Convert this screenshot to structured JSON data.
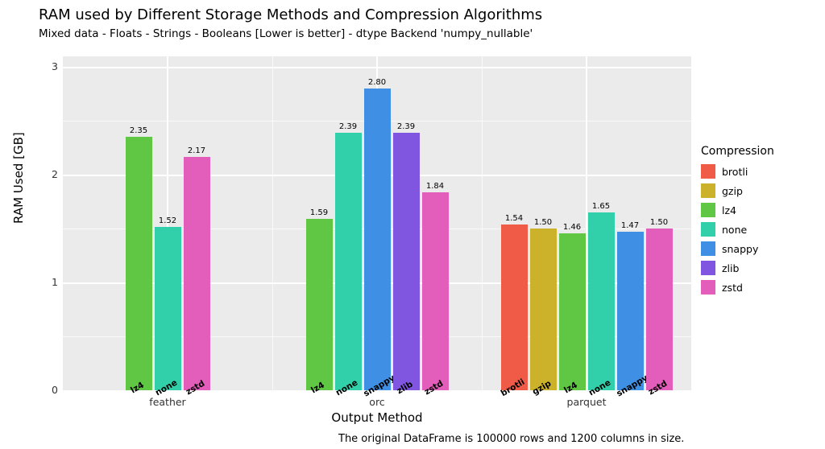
{
  "chart_data": {
    "type": "bar",
    "title": "RAM used by Different Storage Methods and Compression Algorithms",
    "subtitle": "Mixed data - Floats - Strings - Booleans [Lower is better] - dtype Backend 'numpy_nullable'",
    "xlabel": "Output Method",
    "ylabel": "RAM Used [GB]",
    "caption": "The original DataFrame is 100000 rows and 1200 columns in size.",
    "ylim": [
      0,
      3.1
    ],
    "yticks": [
      0,
      1,
      2,
      3
    ],
    "legend_title": "Compression",
    "series": [
      {
        "name": "brotli",
        "color": "#f05b47"
      },
      {
        "name": "gzip",
        "color": "#ccb22b"
      },
      {
        "name": "lz4",
        "color": "#5fc744"
      },
      {
        "name": "none",
        "color": "#32d0aa"
      },
      {
        "name": "snappy",
        "color": "#3f90e5"
      },
      {
        "name": "zlib",
        "color": "#8055e0"
      },
      {
        "name": "zstd",
        "color": "#e35dbb"
      }
    ],
    "groups": [
      {
        "name": "feather",
        "bars": [
          {
            "compression": "lz4",
            "value": 2.35
          },
          {
            "compression": "none",
            "value": 1.52
          },
          {
            "compression": "zstd",
            "value": 2.17
          }
        ]
      },
      {
        "name": "orc",
        "bars": [
          {
            "compression": "lz4",
            "value": 1.59
          },
          {
            "compression": "none",
            "value": 2.39
          },
          {
            "compression": "snappy",
            "value": 2.8
          },
          {
            "compression": "zlib",
            "value": 2.39
          },
          {
            "compression": "zstd",
            "value": 1.84
          }
        ]
      },
      {
        "name": "parquet",
        "bars": [
          {
            "compression": "brotli",
            "value": 1.54
          },
          {
            "compression": "gzip",
            "value": 1.5
          },
          {
            "compression": "lz4",
            "value": 1.46
          },
          {
            "compression": "none",
            "value": 1.65
          },
          {
            "compression": "snappy",
            "value": 1.47
          },
          {
            "compression": "zstd",
            "value": 1.5
          }
        ]
      }
    ]
  }
}
